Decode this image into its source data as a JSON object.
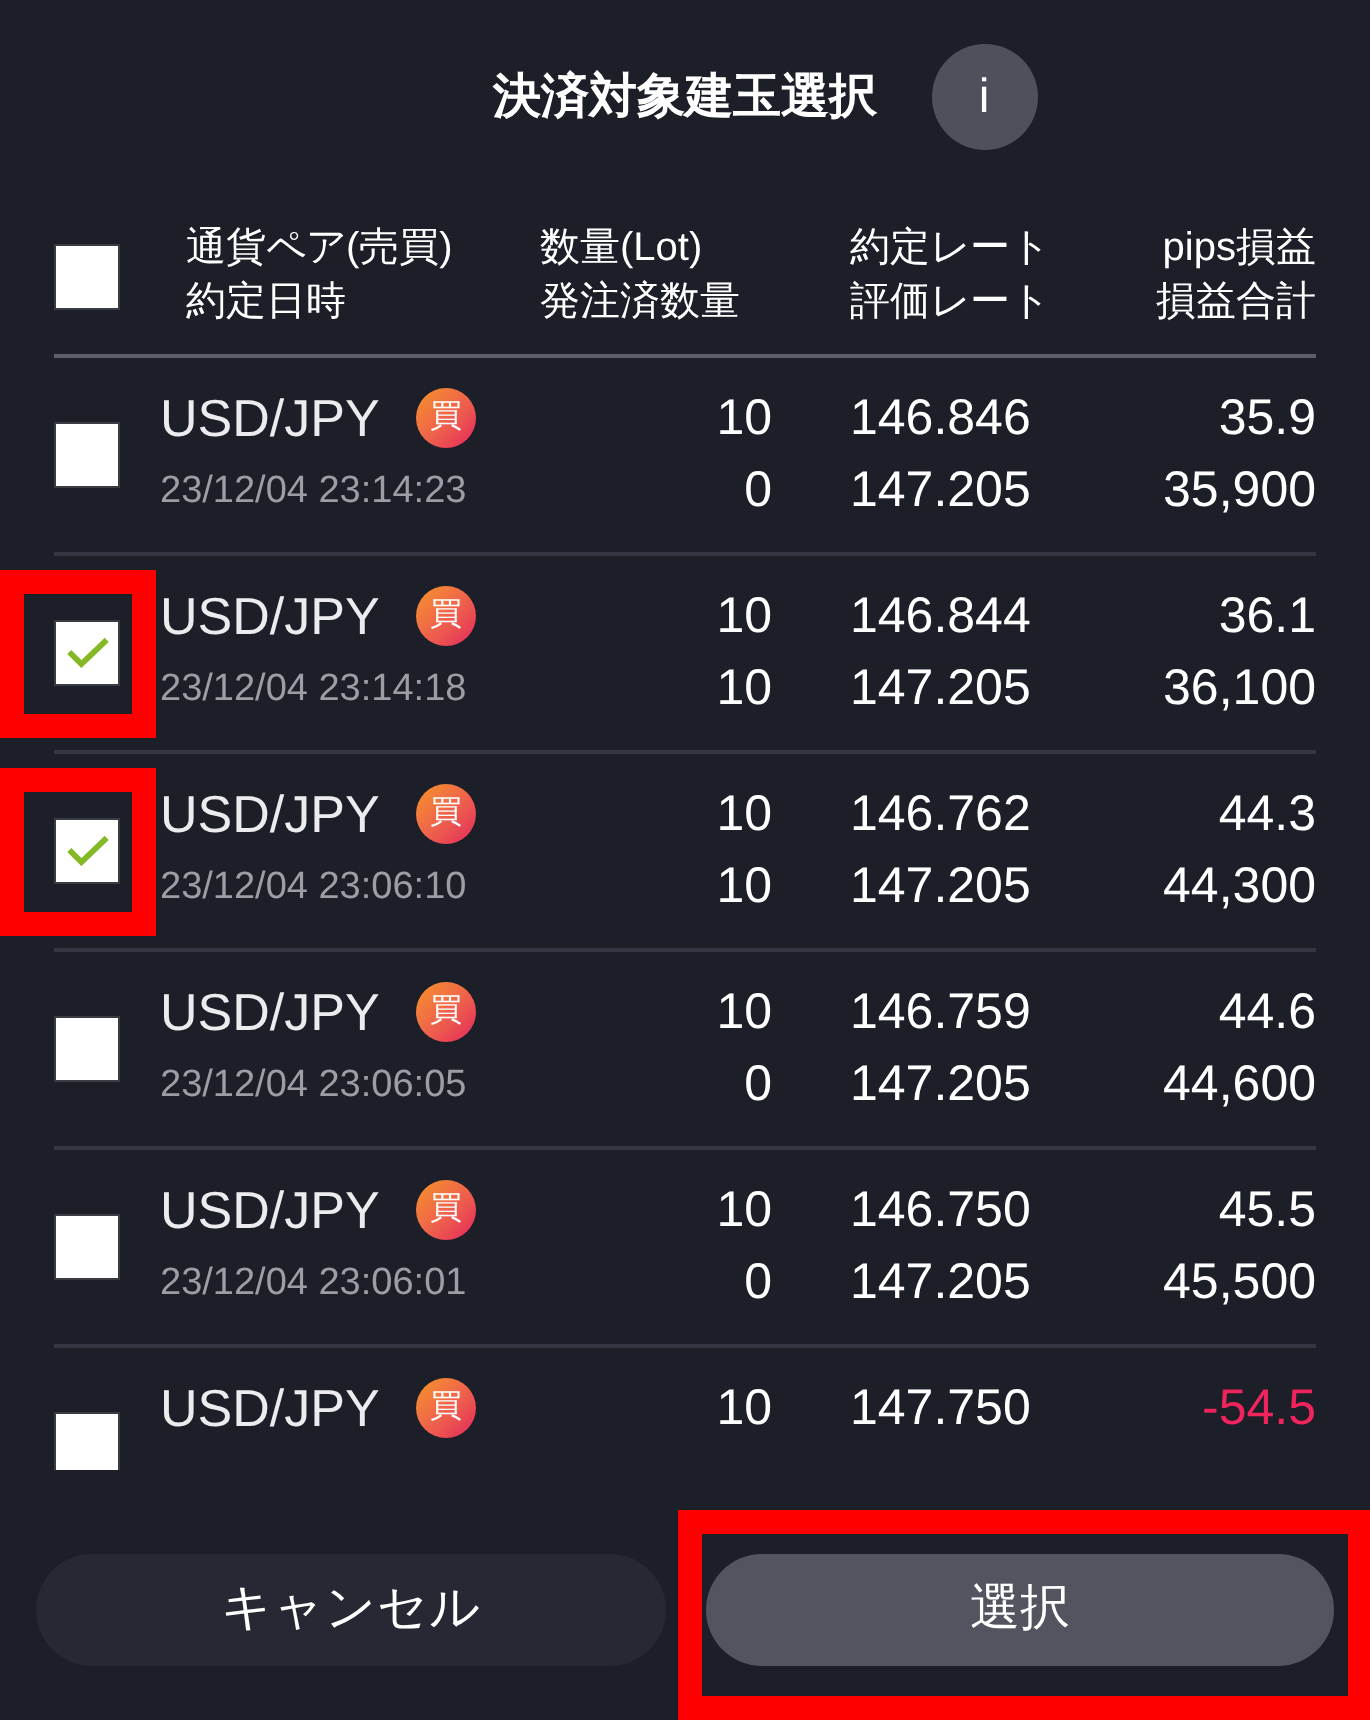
{
  "title": "決済対象建玉選択",
  "info_button": {
    "label": "i"
  },
  "header": {
    "checked": false,
    "columns": [
      {
        "line1": "通貨ペア(売買)",
        "line2": "約定日時"
      },
      {
        "line1": "数量(Lot)",
        "line2": "発注済数量"
      },
      {
        "line1": "約定レート",
        "line2": "評価レート"
      },
      {
        "line1": "pips損益",
        "line2": "損益合計"
      }
    ]
  },
  "rows": [
    {
      "checked": false,
      "highlighted": false,
      "pair": "USD/JPY",
      "side": "買",
      "date": "23/12/04 23:14:23",
      "quantity": "10",
      "ordered": "0",
      "rate": "146.846",
      "valuation": "147.205",
      "pips": "35.9",
      "total": "35,900",
      "negative": false
    },
    {
      "checked": true,
      "highlighted": true,
      "pair": "USD/JPY",
      "side": "買",
      "date": "23/12/04 23:14:18",
      "quantity": "10",
      "ordered": "10",
      "rate": "146.844",
      "valuation": "147.205",
      "pips": "36.1",
      "total": "36,100",
      "negative": false
    },
    {
      "checked": true,
      "highlighted": true,
      "pair": "USD/JPY",
      "side": "買",
      "date": "23/12/04 23:06:10",
      "quantity": "10",
      "ordered": "10",
      "rate": "146.762",
      "valuation": "147.205",
      "pips": "44.3",
      "total": "44,300",
      "negative": false
    },
    {
      "checked": false,
      "highlighted": false,
      "pair": "USD/JPY",
      "side": "買",
      "date": "23/12/04 23:06:05",
      "quantity": "10",
      "ordered": "0",
      "rate": "146.759",
      "valuation": "147.205",
      "pips": "44.6",
      "total": "44,600",
      "negative": false
    },
    {
      "checked": false,
      "highlighted": false,
      "pair": "USD/JPY",
      "side": "買",
      "date": "23/12/04 23:06:01",
      "quantity": "10",
      "ordered": "0",
      "rate": "146.750",
      "valuation": "147.205",
      "pips": "45.5",
      "total": "45,500",
      "negative": false
    },
    {
      "checked": false,
      "highlighted": false,
      "pair": "USD/JPY",
      "side": "買",
      "quantity": "10",
      "rate": "147.750",
      "pips": "-54.5",
      "negative": true
    }
  ],
  "buttons": [
    {
      "label": "キャンセル",
      "kind": "secondary",
      "highlighted": false
    },
    {
      "label": "選択",
      "kind": "primary",
      "highlighted": true
    }
  ]
}
